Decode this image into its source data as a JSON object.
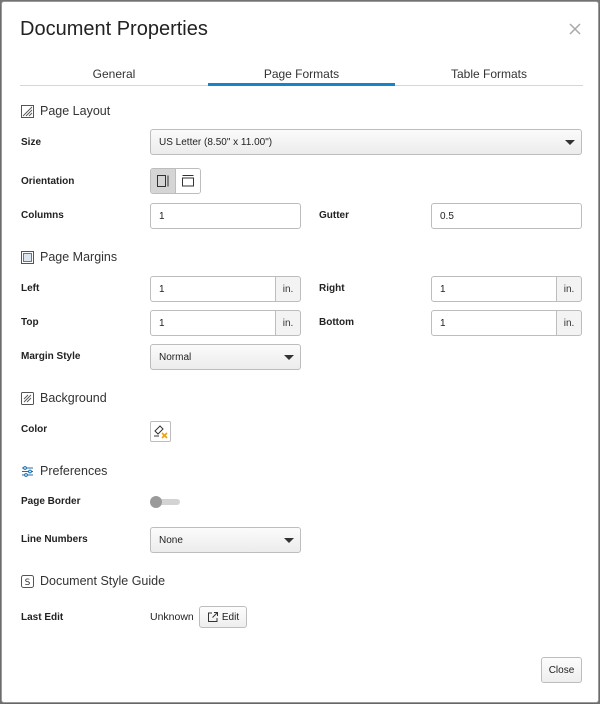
{
  "dialog": {
    "title": "Document Properties",
    "close_icon": "close-icon"
  },
  "tabs": [
    {
      "label": "General",
      "active": false
    },
    {
      "label": "Page Formats",
      "active": true
    },
    {
      "label": "Table Formats",
      "active": false
    }
  ],
  "page_layout": {
    "heading": "Page Layout",
    "icon": "page-layout-icon",
    "size_label": "Size",
    "size_value": "US Letter (8.50\" x 11.00\")",
    "orientation_label": "Orientation",
    "orientation_selected": "portrait",
    "columns_label": "Columns",
    "columns_value": "1",
    "gutter_label": "Gutter",
    "gutter_value": "0.5"
  },
  "page_margins": {
    "heading": "Page Margins",
    "icon": "margins-icon",
    "left_label": "Left",
    "left_value": "1",
    "right_label": "Right",
    "right_value": "1",
    "top_label": "Top",
    "top_value": "1",
    "bottom_label": "Bottom",
    "bottom_value": "1",
    "unit": "in.",
    "margin_style_label": "Margin Style",
    "margin_style_value": "Normal"
  },
  "background": {
    "heading": "Background",
    "icon": "background-icon",
    "color_label": "Color",
    "color_value": "none"
  },
  "preferences": {
    "heading": "Preferences",
    "icon": "preferences-icon",
    "page_border_label": "Page Border",
    "page_border_on": false,
    "line_numbers_label": "Line Numbers",
    "line_numbers_value": "None"
  },
  "style_guide": {
    "heading": "Document Style Guide",
    "icon": "style-guide-icon",
    "last_edit_label": "Last Edit",
    "last_edit_value": "Unknown",
    "edit_button": "Edit"
  },
  "footer": {
    "close_button": "Close"
  },
  "colors": {
    "accent": "#1a82c8"
  }
}
